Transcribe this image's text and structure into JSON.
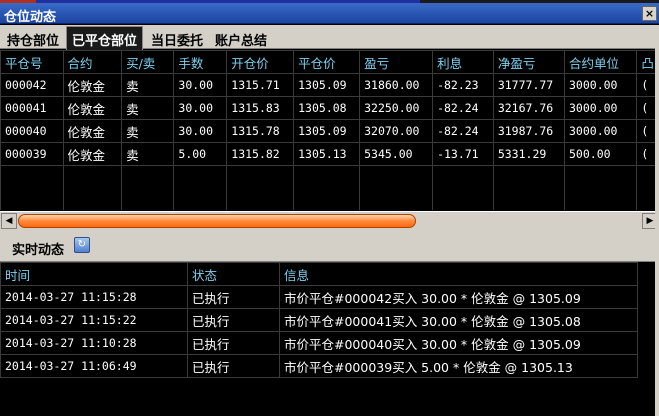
{
  "window": {
    "title": "仓位动态",
    "close_label": "×"
  },
  "tabs": [
    {
      "label": "持仓部位"
    },
    {
      "label": "已平仓部位"
    },
    {
      "label": "当日委托"
    },
    {
      "label": "账户总结"
    }
  ],
  "closed_positions": {
    "columns": [
      "平仓号",
      "合约",
      "买/卖",
      "手数",
      "开仓价",
      "平仓价",
      "盈亏",
      "利息",
      "净盈亏",
      "合约单位",
      "凸"
    ],
    "rows": [
      [
        "000042",
        "伦敦金",
        "卖",
        "30.00",
        "1315.71",
        "1305.09",
        "31860.00",
        "-82.23",
        "31777.77",
        "3000.00",
        "("
      ],
      [
        "000041",
        "伦敦金",
        "卖",
        "30.00",
        "1315.83",
        "1305.08",
        "32250.00",
        "-82.24",
        "32167.76",
        "3000.00",
        "("
      ],
      [
        "000040",
        "伦敦金",
        "卖",
        "30.00",
        "1315.78",
        "1305.09",
        "32070.00",
        "-82.24",
        "31987.76",
        "3000.00",
        "("
      ],
      [
        "000039",
        "伦敦金",
        "卖",
        "5.00",
        "1315.82",
        "1305.13",
        "5345.00",
        "-13.71",
        "5331.29",
        "500.00",
        "("
      ]
    ]
  },
  "realtime": {
    "label": "实时动态",
    "icon": "refresh-icon",
    "columns": [
      "时间",
      "状态",
      "信息"
    ],
    "rows": [
      [
        "2014-03-27 11:15:28",
        "已执行",
        "市价平仓#000042买入 30.00 * 伦敦金 @ 1305.09"
      ],
      [
        "2014-03-27 11:15:22",
        "已执行",
        "市价平仓#000041买入 30.00 * 伦敦金 @ 1305.08"
      ],
      [
        "2014-03-27 11:10:28",
        "已执行",
        "市价平仓#000040买入 30.00 * 伦敦金 @ 1305.09"
      ],
      [
        "2014-03-27 11:06:49",
        "已执行",
        "市价平仓#000039买入 5.00 * 伦敦金 @ 1305.13"
      ]
    ]
  },
  "colors": {
    "header_text": "#7ed0f0",
    "title_bar": "#2a55b8",
    "scroll_thumb": "#ff7a20"
  }
}
